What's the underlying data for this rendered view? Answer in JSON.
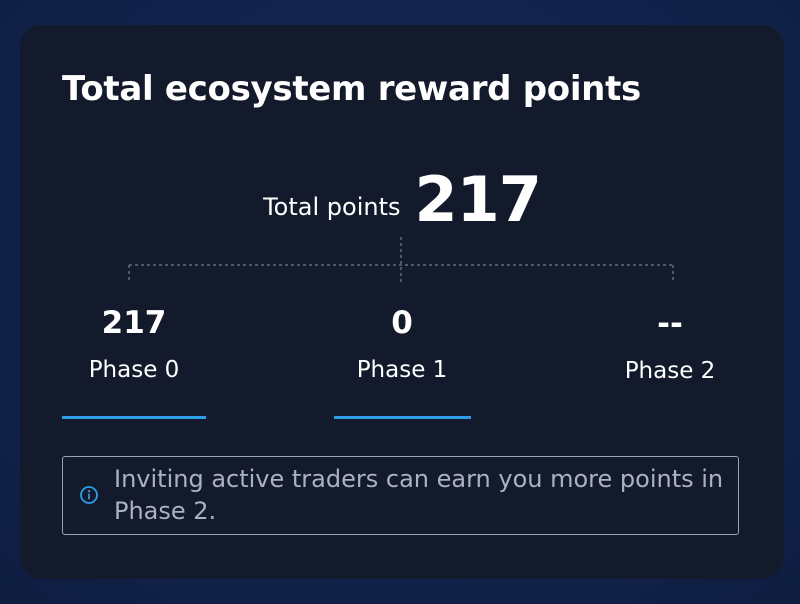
{
  "card": {
    "title": "Total ecosystem reward points"
  },
  "total": {
    "label": "Total points",
    "value": "217"
  },
  "phases": [
    {
      "value": "217",
      "label": "Phase 0",
      "underlined": true
    },
    {
      "value": "0",
      "label": "Phase 1",
      "underlined": true
    },
    {
      "value": "--",
      "label": "Phase 2",
      "underlined": false
    }
  ],
  "info": {
    "icon": "info-circle-icon",
    "text": "Inviting active traders can earn you more points in Phase 2."
  },
  "colors": {
    "background": "#12244d",
    "card": "#131a2b",
    "accent": "#2e9ce6",
    "muted_text": "#aab2c1",
    "border": "#9aa2b1"
  }
}
